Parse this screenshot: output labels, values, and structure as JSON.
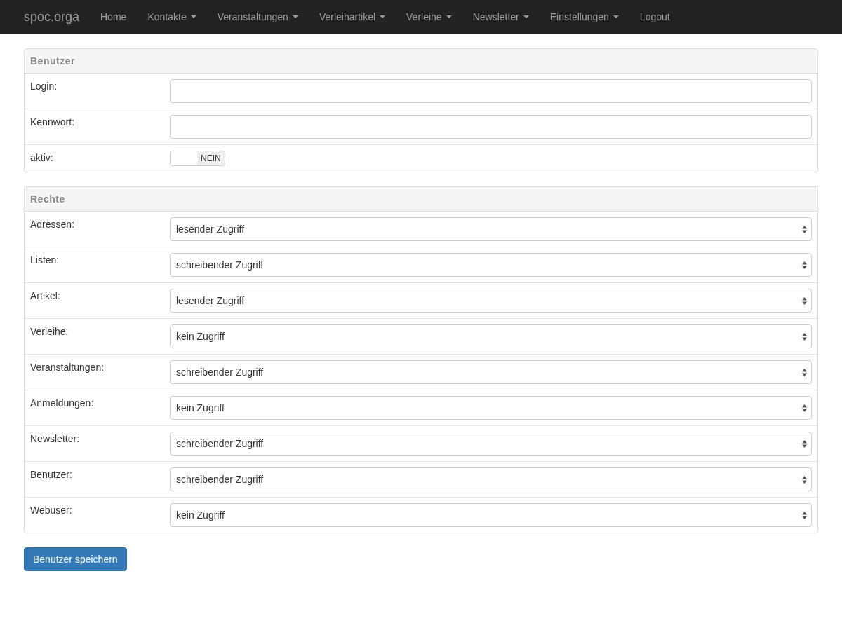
{
  "navbar": {
    "brand": "spoc.orga",
    "items": [
      {
        "label": "Home",
        "dropdown": false
      },
      {
        "label": "Kontakte",
        "dropdown": true
      },
      {
        "label": "Veranstaltungen",
        "dropdown": true
      },
      {
        "label": "Verleihartikel",
        "dropdown": true
      },
      {
        "label": "Verleihe",
        "dropdown": true
      },
      {
        "label": "Newsletter",
        "dropdown": true
      },
      {
        "label": "Einstellungen",
        "dropdown": true
      },
      {
        "label": "Logout",
        "dropdown": false
      }
    ]
  },
  "panels": [
    {
      "title": "Benutzer",
      "rows": [
        {
          "kind": "text",
          "label": "Login:"
        },
        {
          "kind": "text",
          "label": "Kennwort:"
        },
        {
          "kind": "toggle",
          "label": "aktiv:",
          "on": false,
          "state_label": "NEIN"
        }
      ]
    },
    {
      "title": "Rechte",
      "rows": [
        {
          "kind": "select",
          "label": "Adressen:",
          "value": "lesender Zugriff"
        },
        {
          "kind": "select",
          "label": "Listen:",
          "value": "schreibender Zugriff"
        },
        {
          "kind": "select",
          "label": "Artikel:",
          "value": "lesender Zugriff"
        },
        {
          "kind": "select",
          "label": "Verleihe:",
          "value": "kein Zugriff"
        },
        {
          "kind": "select",
          "label": "Veranstaltungen:",
          "value": "schreibender Zugriff"
        },
        {
          "kind": "select",
          "label": "Anmeldungen:",
          "value": "kein Zugriff"
        },
        {
          "kind": "select",
          "label": "Newsletter:",
          "value": "schreibender Zugriff"
        },
        {
          "kind": "select",
          "label": "Benutzer:",
          "value": "schreibender Zugriff"
        },
        {
          "kind": "select",
          "label": "Webuser:",
          "value": "kein Zugriff"
        }
      ]
    }
  ],
  "save_button": "Benutzer speichern"
}
